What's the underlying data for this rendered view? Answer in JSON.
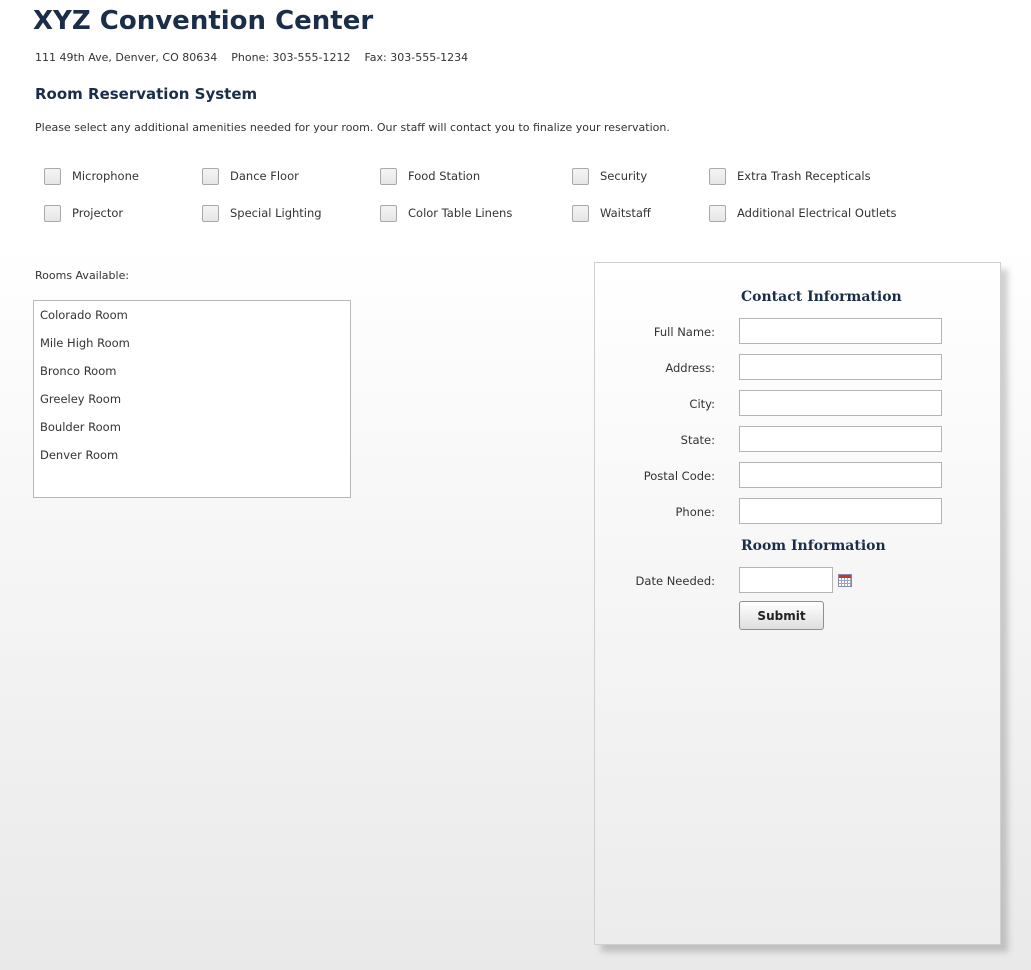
{
  "header": {
    "title": "XYZ Convention Center",
    "address": "111 49th Ave, Denver, CO 80634",
    "phone": "Phone: 303-555-1212",
    "fax": "Fax: 303-555-1234",
    "subtitle": "Room Reservation System",
    "instructions": "Please select any additional amenities needed for your room. Our staff will contact you to finalize your reservation."
  },
  "amenities": [
    {
      "label": "Microphone",
      "checked": false
    },
    {
      "label": "Dance Floor",
      "checked": false
    },
    {
      "label": "Food Station",
      "checked": false
    },
    {
      "label": "Security",
      "checked": false
    },
    {
      "label": "Extra Trash Recepticals",
      "checked": false
    },
    {
      "label": "Projector",
      "checked": false
    },
    {
      "label": "Special Lighting",
      "checked": false
    },
    {
      "label": "Color Table Linens",
      "checked": false
    },
    {
      "label": "Waitstaff",
      "checked": false
    },
    {
      "label": "Additional Electrical Outlets",
      "checked": false
    }
  ],
  "rooms": {
    "label": "Rooms Available:",
    "items": [
      "Colorado Room",
      "Mile High Room",
      "Bronco Room",
      "Greeley Room",
      "Boulder Room",
      "Denver Room"
    ]
  },
  "form": {
    "contact_heading": "Contact Information",
    "fields": {
      "full_name": {
        "label": "Full Name:",
        "value": ""
      },
      "address": {
        "label": "Address:",
        "value": ""
      },
      "city": {
        "label": "City:",
        "value": ""
      },
      "state": {
        "label": "State:",
        "value": ""
      },
      "postal_code": {
        "label": "Postal Code:",
        "value": ""
      },
      "phone": {
        "label": "Phone:",
        "value": ""
      }
    },
    "room_heading": "Room Information",
    "date_needed": {
      "label": "Date Needed:",
      "value": ""
    },
    "submit_label": "Submit"
  },
  "icons": {
    "calendar": "calendar-icon"
  },
  "colors": {
    "heading": "#1a2e4a",
    "panel_border": "#d0d0d0"
  }
}
